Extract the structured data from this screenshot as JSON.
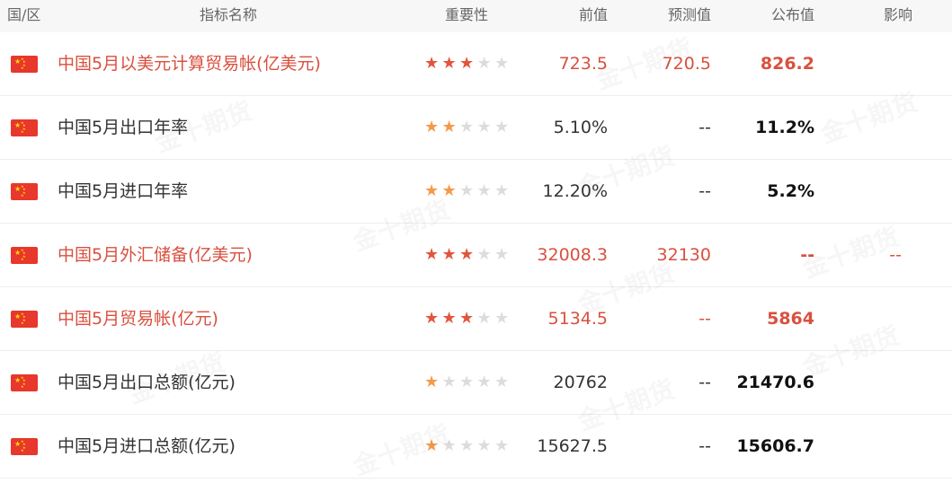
{
  "header": {
    "country": "国/区",
    "indicator": "指标名称",
    "importance": "重要性",
    "previous": "前值",
    "forecast": "预测值",
    "published": "公布值",
    "impact": "影响"
  },
  "watermark": "金十期货",
  "rows": [
    {
      "name": "中国5月以美元计算贸易帐(亿美元)",
      "stars": 3,
      "important": true,
      "previous": "723.5",
      "forecast": "720.5",
      "published": "826.2",
      "impact": ""
    },
    {
      "name": "中国5月出口年率",
      "stars": 2,
      "important": false,
      "previous": "5.10%",
      "forecast": "--",
      "published": "11.2%",
      "impact": ""
    },
    {
      "name": "中国5月进口年率",
      "stars": 2,
      "important": false,
      "previous": "12.20%",
      "forecast": "--",
      "published": "5.2%",
      "impact": ""
    },
    {
      "name": "中国5月外汇储备(亿美元)",
      "stars": 3,
      "important": true,
      "previous": "32008.3",
      "forecast": "32130",
      "published": "--",
      "impact": "--"
    },
    {
      "name": "中国5月贸易帐(亿元)",
      "stars": 3,
      "important": true,
      "previous": "5134.5",
      "forecast": "--",
      "published": "5864",
      "impact": ""
    },
    {
      "name": "中国5月出口总额(亿元)",
      "stars": 1,
      "important": false,
      "previous": "20762",
      "forecast": "--",
      "published": "21470.6",
      "impact": ""
    },
    {
      "name": "中国5月进口总额(亿元)",
      "stars": 1,
      "important": false,
      "previous": "15627.5",
      "forecast": "--",
      "published": "15606.7",
      "impact": ""
    }
  ]
}
